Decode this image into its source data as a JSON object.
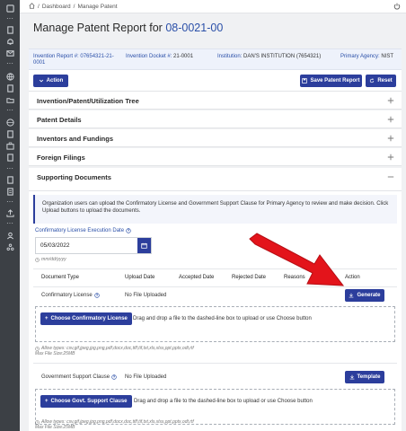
{
  "breadcrumb": {
    "items": [
      "Dashboard",
      "Manage Patent"
    ],
    "separator": "/"
  },
  "page": {
    "title": "Manage Patent Report for",
    "record_id": "08-0021-00"
  },
  "info": {
    "invention_report_label": "Invention Report #:",
    "invention_report_value": "07654321-21-0001",
    "docket_label": "Invention Docket #:",
    "docket_value": "21-0001",
    "institution_label": "Institution:",
    "institution_value": "DAN'S INSTITUTION (7654321)",
    "agency_label": "Primary Agency:",
    "agency_value": "NIST"
  },
  "toolbar": {
    "action_label": "Action",
    "save_label": "Save Patent Report",
    "reset_label": "Reset"
  },
  "sections": [
    {
      "title": "Invention/Patent/Utilization Tree",
      "state": "collapsed"
    },
    {
      "title": "Patent Details",
      "state": "collapsed"
    },
    {
      "title": "Inventors and Fundings",
      "state": "collapsed"
    },
    {
      "title": "Foreign Filings",
      "state": "collapsed"
    },
    {
      "title": "Supporting Documents",
      "state": "expanded"
    }
  ],
  "supporting_docs": {
    "note": "Organization users can upload the Confirmatory License and Government Support Clause for Primary Agency to review and make decision. Click Upload buttons to upload the documents.",
    "exec_date_label": "Confirmatory License Execution Date",
    "exec_date_value": "05/03/2022",
    "exec_date_hint": "mm/dd/yyyy",
    "columns": [
      "Document Type",
      "Upload Date",
      "Accepted Date",
      "Rejected Date",
      "Reasons",
      "Action"
    ],
    "rows": [
      {
        "doc_type": "Confirmatory License",
        "upload_date": "No File Uploaded",
        "action_label": "Generate",
        "choose_label": "Choose Confirmatory License",
        "drop_text": "Drag and drop a file to the dashed-line box to upload or use Choose button",
        "allow_types": "Allow types: csv,gif,jpeg,jpg,png,pdf,docx,doc,tiff,tif,txt,xls,xlsx,ppt,pptx,odt,rtf",
        "max_size": "Max File Size:25MB"
      },
      {
        "doc_type": "Government Support Clause",
        "upload_date": "No File Uploaded",
        "action_label": "Template",
        "choose_label": "Choose Govt. Support Clause",
        "drop_text": "Drag and drop a file to the dashed-line box to upload or use Choose button",
        "allow_types": "Allow types: csv,gif,jpeg,jpg,png,pdf,docx,doc,tiff,tif,txt,xls,xlsx,ppt,pptx,odt,rtf",
        "max_size": "Max File Size:25MB"
      }
    ]
  },
  "colors": {
    "primary": "#2c3e9c",
    "link": "#2a4fa8",
    "rail": "#3c4045",
    "annotation_arrow": "#e3141b"
  },
  "icons": [
    "home-icon",
    "power-icon",
    "chevron-down-icon",
    "save-icon",
    "reset-icon",
    "plus-icon",
    "minus-icon",
    "calendar-icon",
    "help-icon",
    "clock-icon",
    "download-icon",
    "bell-icon",
    "mail-icon",
    "globe-icon",
    "building-icon",
    "file-icon",
    "upload-icon",
    "users-icon"
  ]
}
